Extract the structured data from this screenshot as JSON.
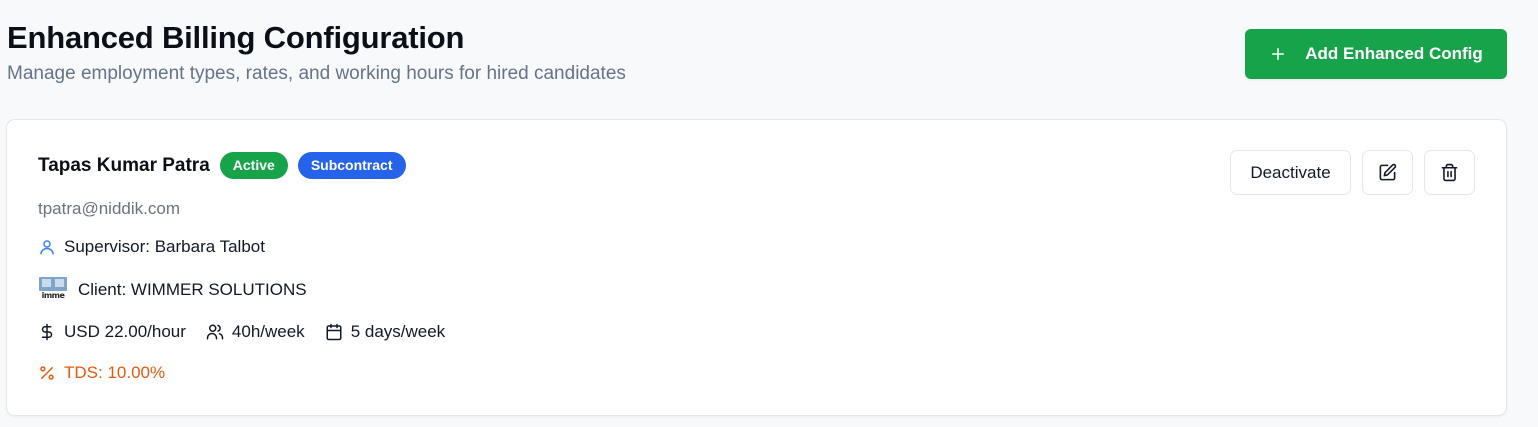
{
  "header": {
    "title": "Enhanced Billing Configuration",
    "subtitle": "Manage employment types, rates, and working hours for hired candidates",
    "add_button_label": "Add Enhanced Config",
    "add_button_icon": "plus-icon"
  },
  "colors": {
    "primary_green": "#16a34a",
    "badge_blue": "#2563eb",
    "tds_orange": "#ea580c",
    "supervisor_icon_blue": "#3b82f6"
  },
  "configs": [
    {
      "name": "Tapas Kumar Patra",
      "status_badge": "Active",
      "type_badge": "Subcontract",
      "email": "tpatra@niddik.com",
      "supervisor": "Supervisor: Barbara Talbot",
      "client": "Client: WIMMER SOLUTIONS",
      "client_logo_text": "imme",
      "rate": "USD 22.00/hour",
      "hours": "40h/week",
      "days": "5 days/week",
      "tds": "TDS: 10.00%",
      "actions": {
        "deactivate_label": "Deactivate",
        "edit_icon": "edit-icon",
        "delete_icon": "trash-icon"
      }
    }
  ]
}
